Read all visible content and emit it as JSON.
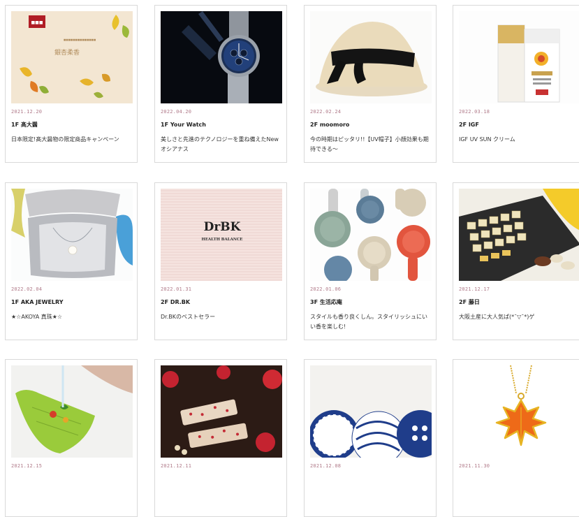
{
  "cards": [
    {
      "date": "2021.12.20",
      "title": "1F 髙大醤",
      "desc": "日本限定!髙大醤物の限定商品キャンペーン",
      "image": "ginkgo-gift-box-image"
    },
    {
      "date": "2022.04.20",
      "title": "1F Your Watch",
      "desc": "美しさと先進のテクノロジーを重ね備えたNewオシアナス",
      "image": "watch-image"
    },
    {
      "date": "2022.02.24",
      "title": "2F moomoro",
      "desc": "今の時期はピッタリ!!【UV帽子】小顔効果も期待できる〜",
      "image": "straw-hat-image"
    },
    {
      "date": "2022.03.18",
      "title": "2F IGF",
      "desc": "IGF UV SUN クリーム",
      "image": "sun-cream-image"
    },
    {
      "date": "2022.02.04",
      "title": "1F AKA JEWELRY",
      "desc": "★☆AKOYA 真珠★☆",
      "image": "pearl-necklace-image"
    },
    {
      "date": "2022.01.31",
      "title": "2F DR.BK",
      "desc": "Dr.BKのベストセラー",
      "image": "dr-bk-logo-image"
    },
    {
      "date": "2022.01.06",
      "title": "3F 生活応庵",
      "desc": "スタイルも香り良くしん。スタイリッシュにいい香を楽しむ!",
      "image": "colorful-spoons-image"
    },
    {
      "date": "2021.12.17",
      "title": "2F 藤日",
      "desc": "大阪土産に大人気ぱ(*¯▽¯*)ゲ",
      "image": "boxed-sweets-image"
    },
    {
      "date": "2021.12.15",
      "title": "",
      "desc": "",
      "image": "green-colander-image"
    },
    {
      "date": "2021.12.11",
      "title": "",
      "desc": "",
      "image": "strawberry-bars-image"
    },
    {
      "date": "2021.12.08",
      "title": "",
      "desc": "",
      "image": "indigo-plates-image"
    },
    {
      "date": "2021.11.30",
      "title": "",
      "desc": "",
      "image": "maple-leaf-pendant-image"
    }
  ],
  "brand": {
    "gift_box_text": "銀杏柔香",
    "dr_bk_logo": "DrBK",
    "dr_bk_subtitle": "HEALTH BALANCE"
  },
  "colors": {
    "date_color": "#b07a89",
    "border": "#d9d9d9"
  }
}
